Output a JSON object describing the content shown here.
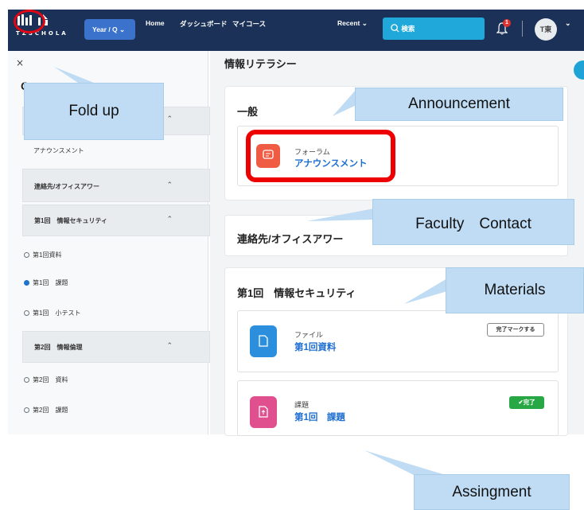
{
  "nav": {
    "logo_text": "TZSCHOLA",
    "year_label": "Year / Q",
    "links": [
      "Home",
      "ダッシュボード",
      "マイコース"
    ],
    "recent_label": "Recent",
    "search_placeholder": "検索",
    "notification_count": "1",
    "avatar_initials": "T東"
  },
  "sidebar": {
    "close_label": "×",
    "header_letter": "C",
    "announcement_item": "アナウンスメント",
    "sections": [
      {
        "label": "連絡先/オフィスアワー"
      },
      {
        "label": "第1回　情報セキュリティ",
        "items": [
          "第1回資料",
          "第1回　課題",
          "第1回　小テスト"
        ]
      },
      {
        "label": "第2回　情報倫理",
        "items": [
          "第2回　資料",
          "第2回　課題"
        ]
      }
    ]
  },
  "main": {
    "page_title": "情報リテラシー",
    "general": {
      "title": "一般",
      "activity": {
        "type": "フォーラム",
        "name": "アナウンスメント",
        "icon": "forum-icon",
        "color": "#ef5c43"
      }
    },
    "contact": {
      "title": "連絡先/オフィスアワー"
    },
    "week1": {
      "title": "第1回　情報セキュリティ",
      "activities": [
        {
          "type": "ファイル",
          "name": "第1回資料",
          "icon": "file-icon",
          "color": "#2b8fde",
          "button": "完了マークする"
        },
        {
          "type": "課題",
          "name": "第1回　課題",
          "icon": "assignment-icon",
          "color": "#e0508f",
          "button": "✔完了"
        }
      ]
    }
  },
  "callouts": {
    "fold_up": "Fold up",
    "announcement": "Announcement",
    "faculty_contact": "Faculty　Contact",
    "materials": "Materials",
    "assignment": "Assingment"
  },
  "colors": {
    "nav": "#1b3157",
    "accent": "#1fa8d9",
    "highlight": "#ef0000",
    "callout": "#bfdcf4"
  }
}
